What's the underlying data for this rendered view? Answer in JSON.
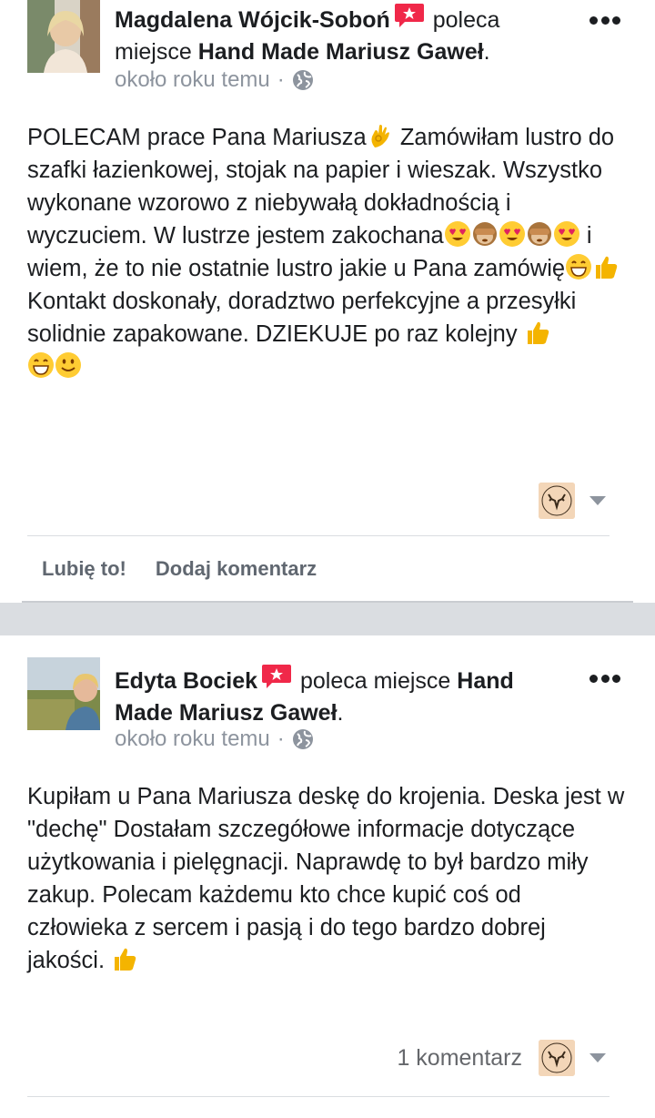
{
  "posts": [
    {
      "author": "Magdalena Wójcik-Soboń",
      "verb": "poleca",
      "verb2": "miejsce",
      "place": "Hand Made Mariusz Gaweł",
      "time": "około roku temu",
      "separator": "·",
      "body": [
        "POLECAM prace Pana Mariusza",
        " Zamówiłam lustro do szafki łazienkowej, stojak na papier i wieszak. Wszystko wykonane wzorowo z niebywałą dokładnością i wyczuciem. W lustrze jestem zakochana",
        " i wiem, że to nie ostatnie lustro jakie u Pana zamówię",
        " Kontakt doskonały, doradztwo perfekcyjne a przesyłki solidnie zapakowane. DZIEKUJE po raz kolejny "
      ],
      "actions": {
        "like": "Lubię to!",
        "comment": "Dodaj komentarz"
      },
      "comments_count": ""
    },
    {
      "author": "Edyta Bociek",
      "verb": "poleca miejsce",
      "place": "Hand Made Mariusz Gaweł",
      "time": "około roku temu",
      "separator": "·",
      "body": [
        "Kupiłam u Pana Mariusza deskę do krojenia. Deska jest w \"dechę\" Dostałam szczegółowe informacje dotyczące użytkowania i pielęgnacji. Naprawdę to był bardzo miły zakup. Polecam każdemu kto chce kupić coś od człowieka z sercem i pasją i do tego bardzo dobrej jakości. "
      ],
      "comments_count": "1 komentarz"
    }
  ],
  "icons": {
    "recommend_badge": "recommend-badge-icon",
    "globe": "globe-icon",
    "more": "more-options-icon",
    "caret": "caret-down-icon"
  },
  "colors": {
    "badge": "#f02849",
    "secondary_text": "#8d949e",
    "separator": "#dadde1"
  }
}
